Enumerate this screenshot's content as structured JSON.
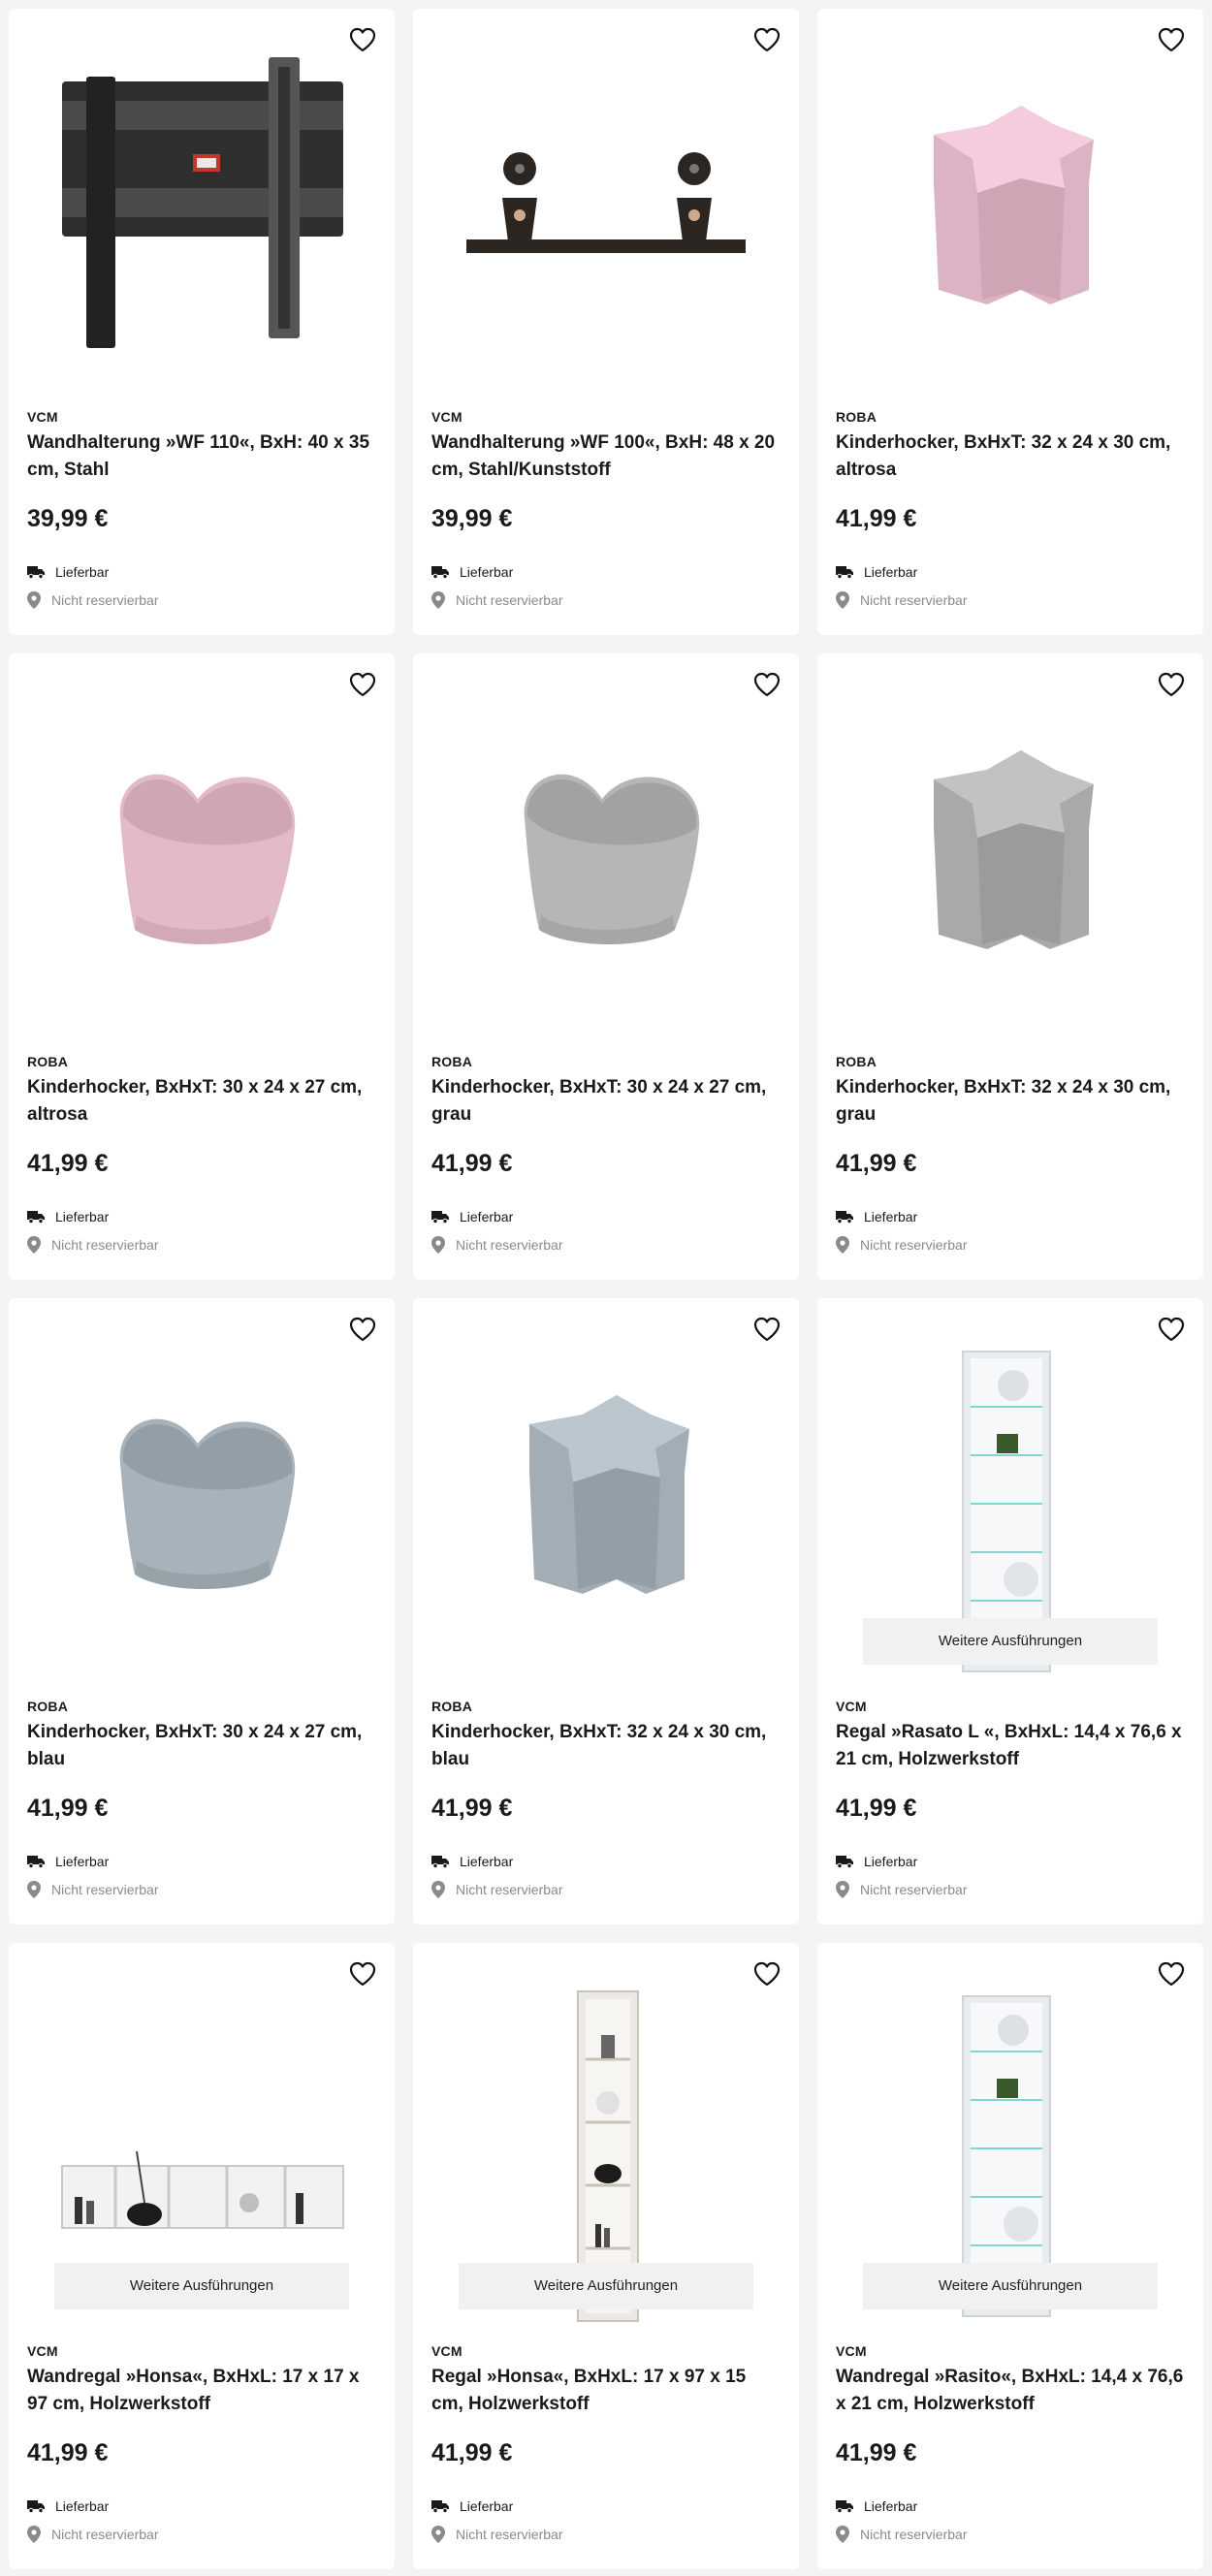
{
  "products": [
    {
      "brand": "VCM",
      "title": "Wandhalterung »WF 110«, BxH: 40 x 35 cm, Stahl",
      "price": "39,99 €",
      "image": "tv-wall-mount-tilt",
      "color": "#3a3a3a"
    },
    {
      "brand": "VCM",
      "title": "Wandhalterung »WF 100«, BxH: 48 x 20 cm, Stahl/Kunststoff",
      "price": "39,99 €",
      "image": "tv-wall-mount-bar",
      "color": "#2b2622"
    },
    {
      "brand": "ROBA",
      "title": "Kinderhocker, BxHxT: 32 x 24 x 30 cm, altrosa",
      "price": "41,99 €",
      "image": "star-stool",
      "color": "#dcb3c4"
    },
    {
      "brand": "ROBA",
      "title": "Kinderhocker, BxHxT: 30 x 24 x 27 cm, altrosa",
      "price": "41,99 €",
      "image": "heart-stool",
      "color": "#e3bac8"
    },
    {
      "brand": "ROBA",
      "title": "Kinderhocker, BxHxT: 30 x 24 x 27 cm, grau",
      "price": "41,99 €",
      "image": "heart-stool",
      "color": "#b6b6b4"
    },
    {
      "brand": "ROBA",
      "title": "Kinderhocker, BxHxT: 32 x 24 x 30 cm, grau",
      "price": "41,99 €",
      "image": "star-stool",
      "color": "#a9aaa8"
    },
    {
      "brand": "ROBA",
      "title": "Kinderhocker, BxHxT: 30 x 24 x 27 cm, blau",
      "price": "41,99 €",
      "image": "heart-stool",
      "color": "#a7b2ba"
    },
    {
      "brand": "ROBA",
      "title": "Kinderhocker, BxHxT: 32 x 24 x 30 cm, blau",
      "price": "41,99 €",
      "image": "star-stool",
      "color": "#a2adb6"
    },
    {
      "brand": "VCM",
      "title": "Regal »Rasato L «, BxHxL: 14,4 x 76,6 x 21 cm, Holzwerkstoff",
      "price": "41,99 €",
      "image": "glass-shelf",
      "color": "#e9ecee",
      "variants": "Weitere Ausführungen"
    },
    {
      "brand": "VCM",
      "title": "Wandregal »Honsa«, BxHxL: 17 x 17 x 97 cm, Holzwerkstoff",
      "price": "41,99 €",
      "image": "horizontal-wall-shelf",
      "color": "#f2f2f2",
      "variants": "Weitere Ausführungen"
    },
    {
      "brand": "VCM",
      "title": "Regal »Honsa«, BxHxL: 17 x 97 x 15 cm, Holzwerkstoff",
      "price": "41,99 €",
      "image": "vertical-shelf",
      "color": "#ece9e4",
      "variants": "Weitere Ausführungen"
    },
    {
      "brand": "VCM",
      "title": "Wandregal »Rasito«, BxHxL: 14,4 x 76,6 x 21 cm, Holzwerkstoff",
      "price": "41,99 €",
      "image": "glass-shelf",
      "color": "#e9ecee",
      "variants": "Weitere Ausführungen"
    }
  ],
  "labels": {
    "delivery": "Lieferbar",
    "reservation": "Nicht reservierbar"
  },
  "icons": {
    "favorite": "heart-outline-icon",
    "delivery": "truck-icon",
    "reservation": "location-pin-icon"
  }
}
